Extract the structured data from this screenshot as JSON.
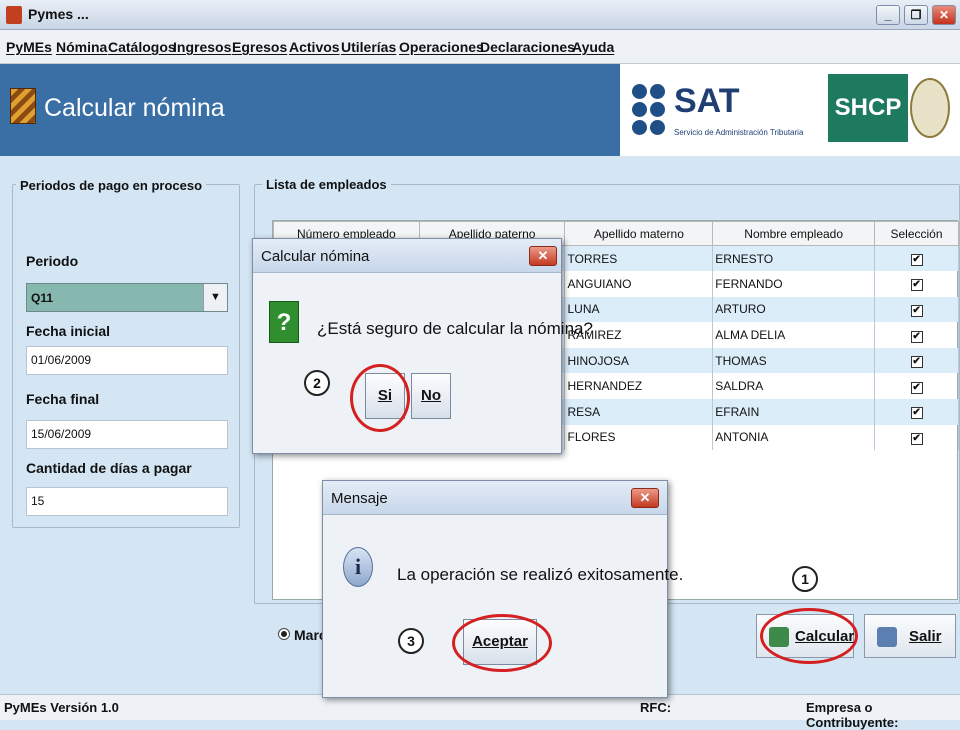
{
  "window": {
    "title": "Pymes ...",
    "minimize": "_",
    "maximize": "❐",
    "close": "✕"
  },
  "menu": [
    "PyMEs",
    "Nómina",
    "Catálogos",
    "Ingresos",
    "Egresos",
    "Activos",
    "Utilerías",
    "Operaciones",
    "Declaraciones",
    "Ayuda"
  ],
  "header": {
    "title": "Calcular nómina"
  },
  "brand": {
    "sat": "SAT",
    "sat_sub": "Servicio de Administración Tributaria",
    "shcp": "SHCP"
  },
  "periodos": {
    "title": "Periodos de pago en proceso",
    "periodo_label": "Periodo",
    "periodo_value": "Q11",
    "fecha_inicial_label": "Fecha inicial",
    "fecha_inicial": "01/06/2009",
    "fecha_final_label": "Fecha final",
    "fecha_final": "15/06/2009",
    "dias_label": "Cantidad de días a pagar",
    "dias": "15"
  },
  "lista": {
    "title": "Lista de empleados",
    "columns": [
      "Número empleado",
      "Apellido paterno",
      "Apellido materno",
      "Nombre empleado",
      "Selección"
    ],
    "rows": [
      {
        "materno": "TORRES",
        "nombre": "ERNESTO",
        "sel": "✔"
      },
      {
        "materno": "ANGUIANO",
        "nombre": "FERNANDO",
        "sel": "✔"
      },
      {
        "materno": "LUNA",
        "nombre": "ARTURO",
        "sel": "✔"
      },
      {
        "materno": "RAMIREZ",
        "nombre": "ALMA DELIA",
        "sel": "✔"
      },
      {
        "materno": "HINOJOSA",
        "nombre": "THOMAS",
        "sel": "✔"
      },
      {
        "materno": "HERNANDEZ",
        "nombre": "SALDRA",
        "sel": "✔"
      },
      {
        "materno": "RESA",
        "nombre": "EFRAIN",
        "sel": "✔"
      },
      {
        "materno": "FLORES",
        "nombre": "ANTONIA",
        "sel": "✔"
      }
    ]
  },
  "bottom": {
    "radio_label": "Marc",
    "calcular": "Calcular",
    "salir": "Salir"
  },
  "status": {
    "version": "PyMEs Versión 1.0",
    "rfc": "RFC:",
    "empresa": "Empresa o Contribuyente:"
  },
  "confirm_dialog": {
    "title": "Calcular nómina",
    "icon": "?",
    "message": "¿Está seguro de calcular la nómina?",
    "yes": "Si",
    "no": "No"
  },
  "message_dialog": {
    "title": "Mensaje",
    "icon": "i",
    "message": "La operación se realizó exitosamente.",
    "ok": "Aceptar"
  },
  "markers": [
    "1",
    "2",
    "3"
  ],
  "colors": {
    "header_bg": "#3a6fa6",
    "highlight": "#d42020",
    "select_bg": "#86b8b0"
  }
}
